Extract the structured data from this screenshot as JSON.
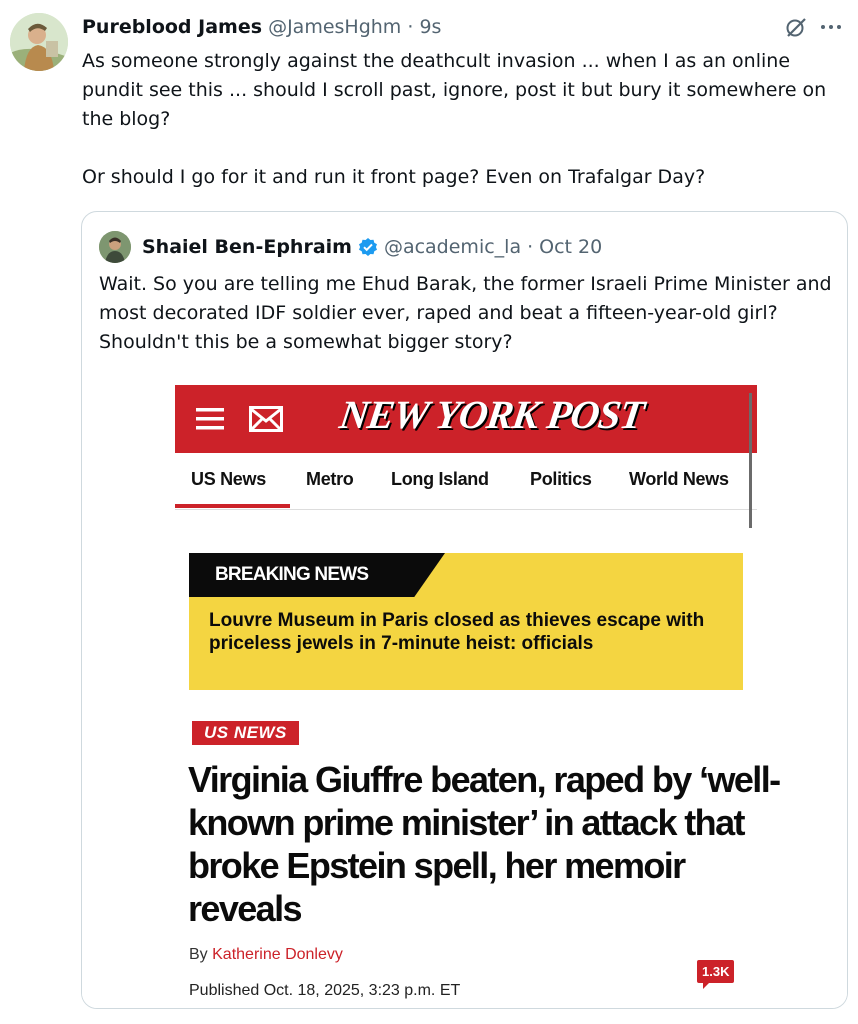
{
  "tweet": {
    "display_name": "Pureblood James",
    "handle": "@JamesHghm",
    "separator": "·",
    "time": "9s",
    "text": "As someone strongly against the deathcult invasion ... when I as an online pundit see this ... should I scroll past, ignore, post it but bury it somewhere on the blog?\n\nOr should I go for it and run it front page? Even on Trafalgar Day?"
  },
  "quoted_tweet": {
    "display_name": "Shaiel Ben-Ephraim",
    "handle": "@academic_la",
    "separator": "·",
    "date": "Oct 20",
    "text": "Wait. So you are telling me Ehud Barak, the former Israeli Prime Minister and most decorated IDF soldier ever, raped and beat a fifteen-year-old girl? Shouldn't this be a somewhat bigger story?"
  },
  "article": {
    "masthead": "NEW YORK POST",
    "nav": [
      "US News",
      "Metro",
      "Long Island",
      "Politics",
      "World News"
    ],
    "breaking_label": "BREAKING NEWS",
    "breaking_text": "Louvre Museum in Paris closed as thieves escape with priceless jewels in 7-minute heist: officials",
    "section_tag": "US NEWS",
    "headline": "Virginia Giuffre beaten, raped by ‘well-known prime minister’ in attack that broke Epstein spell, her memoir reveals",
    "byline_prefix": "By",
    "author": "Katherine Donlevy",
    "published": "Published Oct. 18, 2025, 3:23 p.m. ET",
    "comments": "1.3K"
  },
  "colors": {
    "nyp_red": "#cc2229",
    "breaking_yellow": "#f4d541",
    "verified_blue": "#1d9bf0",
    "muted_text": "#536471"
  },
  "icons": [
    "grok-icon",
    "more-icon",
    "verified-badge-icon",
    "hamburger-menu-icon",
    "mail-icon"
  ]
}
